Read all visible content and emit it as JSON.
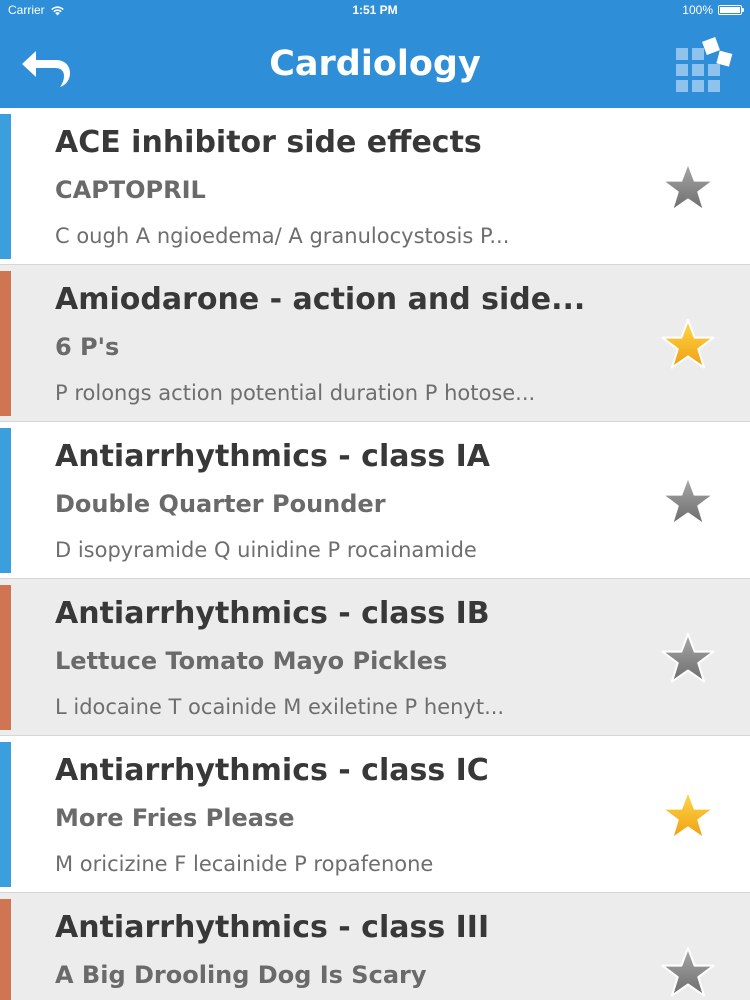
{
  "status_bar": {
    "carrier": "Carrier",
    "time": "1:51 PM",
    "battery": "100%",
    "battery_level": 1.0
  },
  "nav": {
    "title": "Cardiology",
    "back_icon": "back-arrow-icon",
    "menu_icon": "grid-menu-icon"
  },
  "colors": {
    "nav_background": "#2e8fd8",
    "accent_blue": "#3a9fdc",
    "accent_orange": "#cf7551",
    "star_gold": "#f5b922",
    "star_gray": "#8c8c8c"
  },
  "items": [
    {
      "title": "ACE inhibitor side effects",
      "subtitle": "CAPTOPRIL",
      "detail": "C ough   A ngioedema/ A granulocystosis   P...",
      "accent": "blue",
      "favorite": false
    },
    {
      "title": "Amiodarone - action and side...",
      "subtitle": "6 P's",
      "detail": "P rolongs action potential duration   P hotose...",
      "accent": "orange",
      "favorite": true
    },
    {
      "title": "Antiarrhythmics - class IA",
      "subtitle": "Double Quarter Pounder",
      "detail": "D isopyramide   Q uinidine   P rocainamide",
      "accent": "blue",
      "favorite": false
    },
    {
      "title": "Antiarrhythmics - class IB",
      "subtitle": "Lettuce Tomato Mayo Pickles",
      "detail": "L idocaine   T ocainide   M exiletine   P henyt...",
      "accent": "orange",
      "favorite": false
    },
    {
      "title": "Antiarrhythmics - class IC",
      "subtitle": "More Fries Please",
      "detail": "M oricizine   F lecainide   P ropafenone",
      "accent": "blue",
      "favorite": true
    },
    {
      "title": "Antiarrhythmics - class III",
      "subtitle": "A Big Drooling Dog Is Scary",
      "detail": "",
      "accent": "orange",
      "favorite": false
    }
  ]
}
